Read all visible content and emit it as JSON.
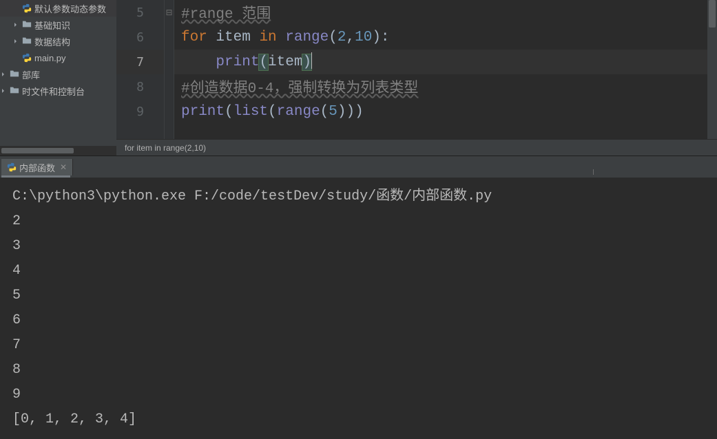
{
  "sidebar": {
    "items": [
      {
        "label": "默认参数动态参数",
        "type": "py-open",
        "indent": 1,
        "chevron": false
      },
      {
        "label": "基础知识",
        "type": "folder",
        "indent": 1,
        "chevron": true
      },
      {
        "label": "数据结构",
        "type": "folder",
        "indent": 1,
        "chevron": true
      },
      {
        "label": "main.py",
        "type": "py",
        "indent": 1,
        "chevron": false
      },
      {
        "label": "部库",
        "type": "lib",
        "indent": 0,
        "chevron": true
      },
      {
        "label": "时文件和控制台",
        "type": "temp",
        "indent": 0,
        "chevron": true
      }
    ]
  },
  "editor": {
    "breadcrumb": "for item in range(2,10)",
    "lines": [
      {
        "no": "5",
        "type": "comment",
        "tokens": [
          {
            "t": "#range 范围",
            "c": "comment underline"
          }
        ],
        "fold": "⊟"
      },
      {
        "no": "6",
        "type": "code",
        "tokens": [
          {
            "t": "for ",
            "c": "kw"
          },
          {
            "t": "item ",
            "c": "plain"
          },
          {
            "t": "in ",
            "c": "kw"
          },
          {
            "t": "range",
            "c": "builtin"
          },
          {
            "t": "(",
            "c": "par"
          },
          {
            "t": "2",
            "c": "num"
          },
          {
            "t": ",",
            "c": "par"
          },
          {
            "t": "10",
            "c": "num"
          },
          {
            "t": "):",
            "c": "par"
          }
        ]
      },
      {
        "no": "7",
        "type": "code",
        "current": true,
        "indent": "    ",
        "tokens": [
          {
            "t": "print",
            "c": "fn"
          },
          {
            "t": "(",
            "c": "par match-br"
          },
          {
            "t": "item",
            "c": "plain"
          },
          {
            "t": ")",
            "c": "par match-br"
          },
          {
            "t": "",
            "c": "caret"
          }
        ]
      },
      {
        "no": "8",
        "type": "comment",
        "tokens": [
          {
            "t": "#创造数据0-4，强制转换为列表类型",
            "c": "comment underline"
          }
        ]
      },
      {
        "no": "9",
        "type": "code",
        "tokens": [
          {
            "t": "print",
            "c": "fn"
          },
          {
            "t": "(",
            "c": "par"
          },
          {
            "t": "list",
            "c": "builtin"
          },
          {
            "t": "(",
            "c": "par"
          },
          {
            "t": "range",
            "c": "builtin"
          },
          {
            "t": "(",
            "c": "par"
          },
          {
            "t": "5",
            "c": "num"
          },
          {
            "t": ")))",
            "c": "par"
          }
        ]
      }
    ]
  },
  "console": {
    "tab_label": "内部函数",
    "lines": [
      "C:\\python3\\python.exe F:/code/testDev/study/函数/内部函数.py",
      "2",
      "3",
      "4",
      "5",
      "6",
      "7",
      "8",
      "9",
      "[0, 1, 2, 3, 4]"
    ]
  }
}
